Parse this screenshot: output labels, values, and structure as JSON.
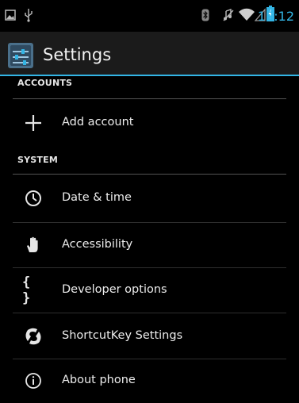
{
  "status_bar": {
    "time": "12:12",
    "icons": [
      "screenshot-icon",
      "usb-icon",
      "bluetooth-icon",
      "muted-icon",
      "wifi-icon",
      "signal-icon",
      "battery-charging-icon"
    ],
    "accent_color": "#33b5e5"
  },
  "action_bar": {
    "icon": "settings-app-icon",
    "title": "Settings"
  },
  "sections": [
    {
      "header": "ACCOUNTS",
      "items": [
        {
          "icon": "plus-icon",
          "label": "Add account"
        }
      ]
    },
    {
      "header": "SYSTEM",
      "items": [
        {
          "icon": "clock-icon",
          "label": "Date & time"
        },
        {
          "icon": "hand-icon",
          "label": "Accessibility"
        },
        {
          "icon": "braces-icon",
          "label": "Developer options"
        },
        {
          "icon": "shortcut-key-icon",
          "label": "ShortcutKey Settings"
        },
        {
          "icon": "info-icon",
          "label": "About phone"
        }
      ]
    }
  ]
}
